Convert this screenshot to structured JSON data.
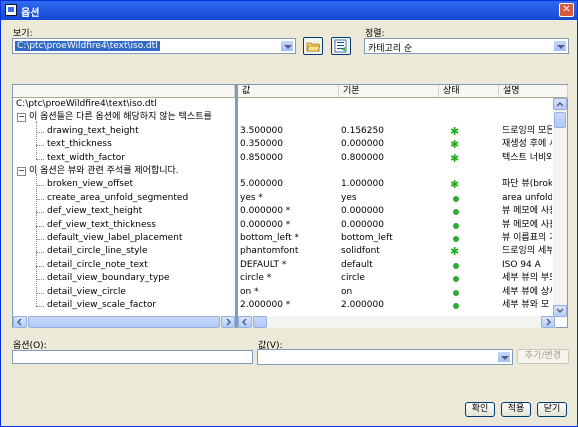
{
  "window": {
    "title": "옵션"
  },
  "view": {
    "label": "보기:",
    "path": "C:\\ptc\\proeWildfire4\\text\\iso.dtl"
  },
  "sort": {
    "label": "정렬:",
    "value": "카테고리 순"
  },
  "table": {
    "headers": {
      "value": "값",
      "default": "기본",
      "status": "상태",
      "description": "설명"
    },
    "root": "C:\\ptc\\proeWildfire4\\text\\iso.dtl",
    "groups": [
      {
        "label": "이 옵션들은 다른 옵션에 해당하지 않는 텍스트를",
        "items": [
          {
            "name": "drawing_text_height",
            "value": "3.500000",
            "default": "0.156250",
            "status": "star",
            "desc": "드로잉의 모든"
          },
          {
            "name": "text_thickness",
            "value": "0.350000",
            "default": "0.000000",
            "status": "star",
            "desc": "재생성 후에 시"
          },
          {
            "name": "text_width_factor",
            "value": "0.850000",
            "default": "0.800000",
            "status": "star",
            "desc": "텍스트 너비와"
          }
        ]
      },
      {
        "label": "이 옵션은 뷰와 관련 주석를 제어합니다.",
        "items": [
          {
            "name": "broken_view_offset",
            "value": "5.000000",
            "default": "1.000000",
            "status": "star",
            "desc": "파단 뷰(broke"
          },
          {
            "name": "create_area_unfold_segmented",
            "value": "yes *",
            "default": "yes",
            "status": "dot",
            "desc": "area unfolde"
          },
          {
            "name": "def_view_text_height",
            "value": "0.000000 *",
            "default": "0.000000",
            "status": "dot",
            "desc": "뷰 메모에 사용"
          },
          {
            "name": "def_view_text_thickness",
            "value": "0.000000 *",
            "default": "0.000000",
            "status": "dot",
            "desc": "뷰 메모에 사용"
          },
          {
            "name": "default_view_label_placement",
            "value": "bottom_left *",
            "default": "bottom_left",
            "status": "dot",
            "desc": "뷰 이름표의 기"
          },
          {
            "name": "detail_circle_line_style",
            "value": "phantomfont",
            "default": "solidfont",
            "status": "star",
            "desc": "드로잉의 세부"
          },
          {
            "name": "detail_circle_note_text",
            "value": "DEFAULT *",
            "default": "default",
            "status": "dot",
            "desc": "ISO 94 A"
          },
          {
            "name": "detail_view_boundary_type",
            "value": "circle *",
            "default": "circle",
            "status": "dot",
            "desc": "세부 뷰의 부모"
          },
          {
            "name": "detail_view_circle",
            "value": "on *",
            "default": "on",
            "status": "dot",
            "desc": "세부 뷰에 상세"
          },
          {
            "name": "detail_view_scale_factor",
            "value": "2.000000 *",
            "default": "2.000000",
            "status": "dot",
            "desc": "세부 뷰와 모"
          }
        ]
      }
    ]
  },
  "option_field": {
    "label": "옵션(O):",
    "value": ""
  },
  "value_field": {
    "label": "값(V):",
    "value": ""
  },
  "buttons": {
    "add_change": "추가/변경",
    "ok": "확인",
    "apply": "적용",
    "close": "닫기"
  },
  "colors": {
    "title_bar": "#1548d0",
    "status_green": "#31a832",
    "selection": "#316ac5"
  }
}
